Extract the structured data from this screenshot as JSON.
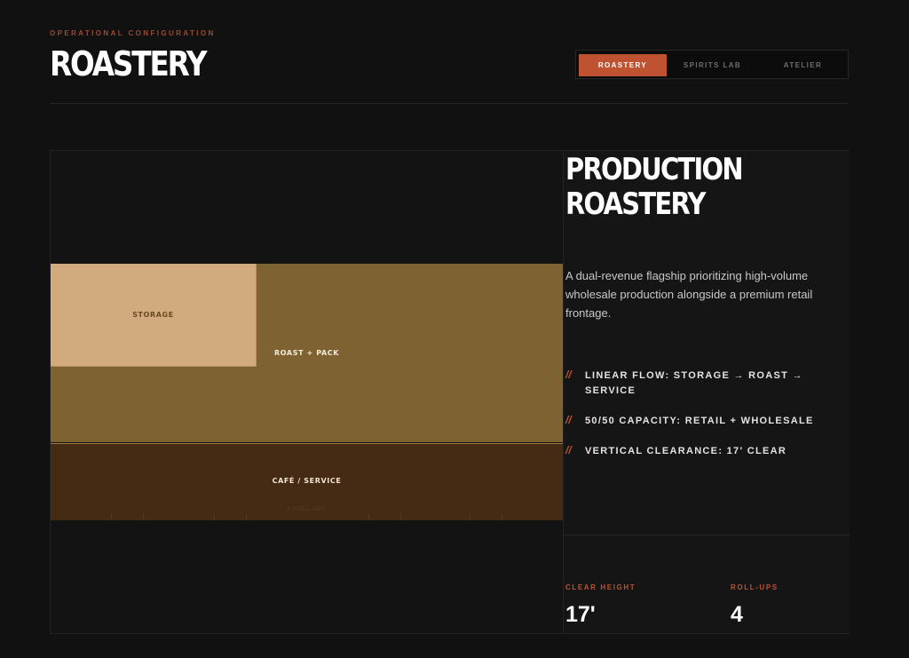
{
  "header": {
    "eyebrow": "OPERATIONAL CONFIGURATION",
    "title": "ROASTERY"
  },
  "tabs": [
    {
      "label": "ROASTERY",
      "active": true
    },
    {
      "label": "SPIRITS LAB",
      "active": false
    },
    {
      "label": "ATELIER",
      "active": false
    }
  ],
  "plan": {
    "zones": {
      "storage": "STORAGE",
      "roast": "ROAST + PACK",
      "cafe": "CAFÉ / SERVICE"
    },
    "cafe_note": "4 ROLL-UPS"
  },
  "info": {
    "title_line1": "PRODUCTION",
    "title_line2": "ROASTERY",
    "description": "A dual-revenue flagship prioritizing high-volume wholesale production alongside a premium retail frontage.",
    "bullet_marker": "//",
    "features": [
      "LINEAR FLOW: STORAGE → ROAST → SERVICE",
      "50/50 CAPACITY: RETAIL + WHOLESALE",
      "VERTICAL CLEARANCE: 17' CLEAR"
    ],
    "stats": [
      {
        "label": "CLEAR HEIGHT",
        "value": "17'"
      },
      {
        "label": "ROLL-UPS",
        "value": "4"
      }
    ]
  },
  "colors": {
    "accent": "#bf5230",
    "storage": "#d1ab7d",
    "roast": "#7f6232",
    "cafe": "#452a14",
    "background": "#111111"
  }
}
